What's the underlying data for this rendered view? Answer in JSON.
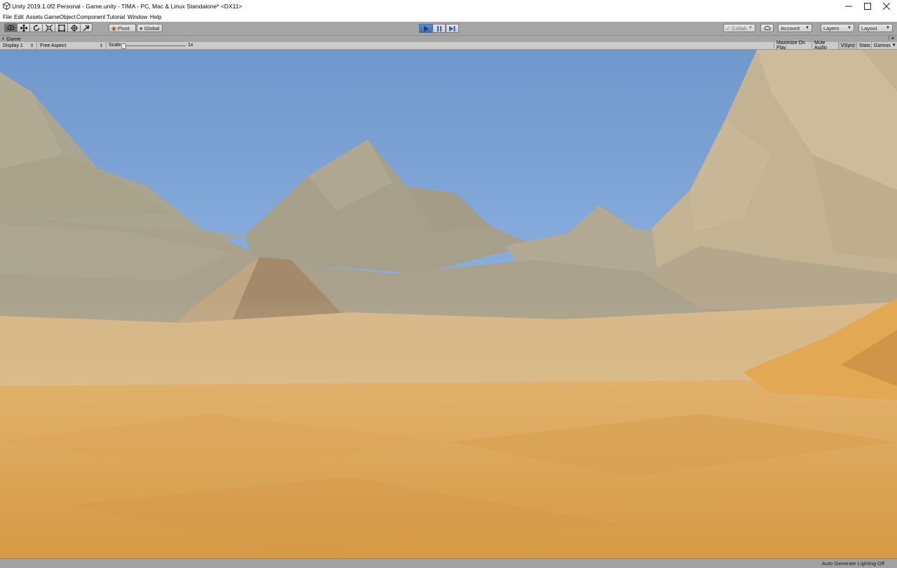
{
  "window": {
    "title": "Unity 2019.1.0f2 Personal - Game.unity - TIMA - PC, Mac & Linux Standalone* <DX11>",
    "controls": {
      "minimize": "—",
      "maximize": "☐",
      "close": "✕"
    }
  },
  "menu": [
    "File",
    "Edit",
    "Assets",
    "GameObject",
    "Component",
    "Tutorial",
    "Window",
    "Help"
  ],
  "toolbar": {
    "tools": [
      "hand-tool",
      "move-tool",
      "rotate-tool",
      "scale-tool",
      "rect-tool",
      "transform-tool",
      "custom-tool"
    ],
    "active_tool": "hand-tool",
    "pivot_label": "Pivot",
    "global_label": "Global",
    "play_state": "playing",
    "collab_label": "Collab",
    "account_label": "Account",
    "layers_label": "Layers",
    "layout_label": "Layout"
  },
  "game_tab": {
    "label": "Game",
    "display": "Display 1",
    "aspect": "Free Aspect",
    "scale_label": "Scale",
    "scale_value": "1x",
    "toggles": [
      "Maximize On Play",
      "Mute Audio",
      "VSync",
      "Stats",
      "Gizmos"
    ]
  },
  "status": {
    "text": "Auto Generate Lighting Off"
  },
  "colors": {
    "sky_top": "#6f94c6",
    "sky_bottom": "#a6c6ea",
    "sand": "#d9a24e",
    "mountain": "#a8a08c",
    "play_accent": "#4a7fc4"
  }
}
